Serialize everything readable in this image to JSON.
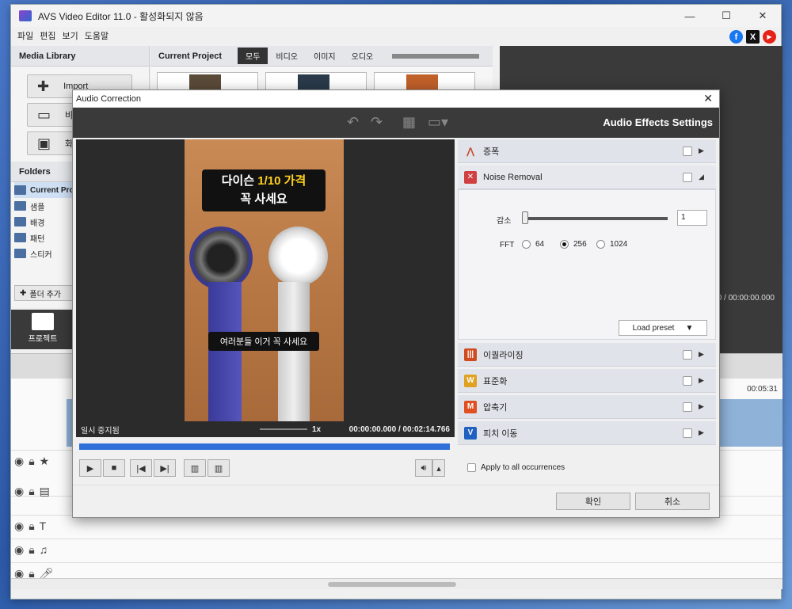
{
  "app": {
    "title": "AVS Video Editor 11.0 - 활성화되지 않음",
    "window_controls": [
      "—",
      "☐",
      "✕"
    ]
  },
  "menu": [
    "파일",
    "편집",
    "보기",
    "도움말"
  ],
  "social": [
    {
      "icon": "facebook-icon",
      "glyph": "f",
      "color": "#1877f2"
    },
    {
      "icon": "x-icon",
      "glyph": "X",
      "color": "#111111"
    },
    {
      "icon": "youtube-icon",
      "glyph": "▶",
      "color": "#e62117"
    }
  ],
  "media_library": {
    "title": "Media Library",
    "buttons": [
      {
        "label": "Import",
        "icon": "plus-icon"
      },
      {
        "label": "비디",
        "icon": "camera-icon"
      },
      {
        "label": "화면",
        "icon": "screen-icon"
      }
    ],
    "folders_title": "Folders",
    "folders": [
      "Current Pro",
      "샘플",
      "배경",
      "패턴",
      "스티커"
    ],
    "add_folder": "폴더 추가"
  },
  "current_project": {
    "title": "Current Project",
    "tabs": [
      "모두",
      "비디오",
      "이미지",
      "오디오"
    ],
    "active_tab": "모두"
  },
  "nav": {
    "label": "프로젝트"
  },
  "preview": {
    "time": "0 / 00:00:00.000"
  },
  "timeline": {
    "end_time": "00:05:31"
  },
  "dialog": {
    "title": "Audio Correction",
    "header": "Audio Effects Settings",
    "video": {
      "caption_top_line1_a": "다이슨 ",
      "caption_top_line1_b": "1/10 가격",
      "caption_top_line2": "꼭 사세요",
      "caption_bottom": "여러분들 이거 꼭 사세요",
      "status": "일시 중지됨",
      "speed": "1x",
      "time": "00:00:00.000  /  00:02:14.766"
    },
    "effects": [
      {
        "label": "증폭",
        "icon": "amplify-icon",
        "color": "#c84a2a",
        "expanded": false
      },
      {
        "label": "Noise Removal",
        "icon": "noise-removal-icon",
        "color": "#d04040",
        "expanded": true
      },
      {
        "label": "이퀄라이징",
        "icon": "equalizer-icon",
        "color": "#d04a20",
        "expanded": false
      },
      {
        "label": "표준화",
        "icon": "normalize-icon",
        "color": "#e0a020",
        "expanded": false
      },
      {
        "label": "압축기",
        "icon": "compressor-icon",
        "color": "#e05020",
        "expanded": false
      },
      {
        "label": "피치 이동",
        "icon": "pitch-shift-icon",
        "color": "#2060c0",
        "expanded": false
      }
    ],
    "noise_removal": {
      "gain_label": "감소",
      "gain_value": "1",
      "fft_label": "FFT",
      "fft_options": [
        "64",
        "256",
        "1024"
      ],
      "fft_selected": "256",
      "preset_label": "Load preset"
    },
    "apply_all": "Apply to all occurrences",
    "ok": "확인",
    "cancel": "취소"
  }
}
